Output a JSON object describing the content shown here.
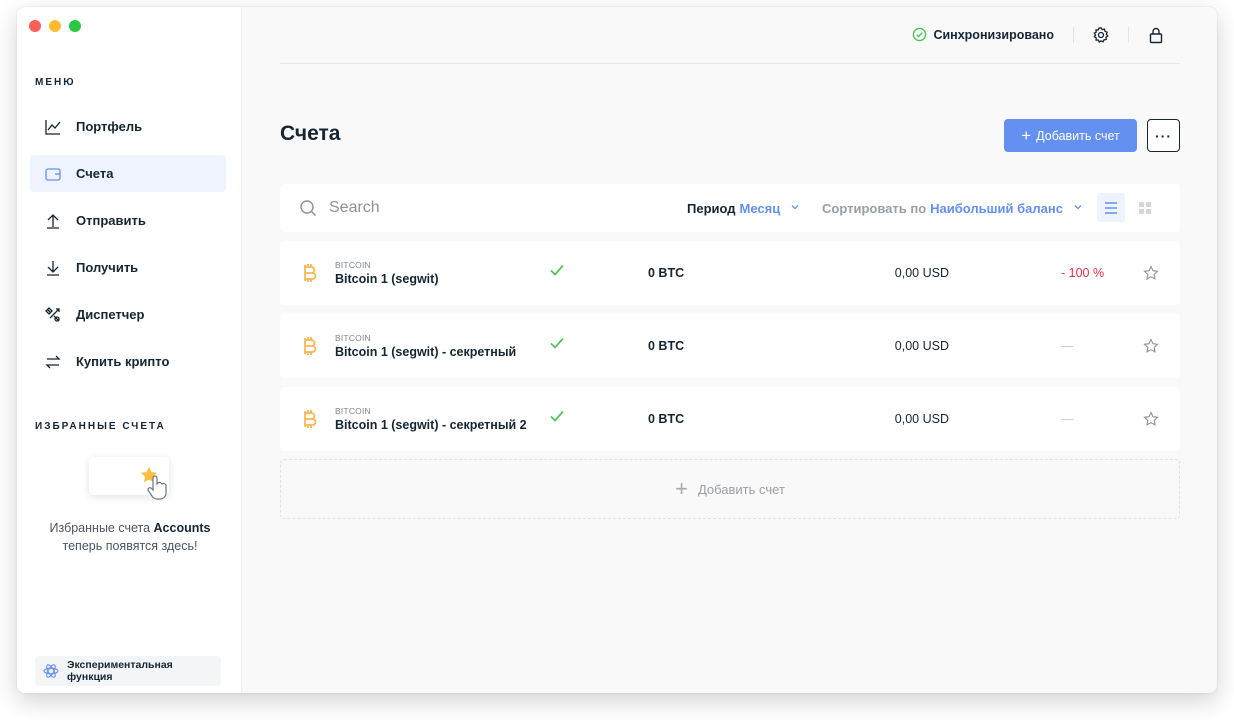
{
  "window": {
    "controls": [
      "close",
      "minimize",
      "maximize"
    ]
  },
  "sidebar": {
    "menu_title": "МЕНЮ",
    "items": [
      {
        "label": "Портфель",
        "icon": "chart-line-icon",
        "active": false
      },
      {
        "label": "Счета",
        "icon": "wallet-icon",
        "active": true
      },
      {
        "label": "Отправить",
        "icon": "arrow-up-icon",
        "active": false
      },
      {
        "label": "Получить",
        "icon": "arrow-down-icon",
        "active": false
      },
      {
        "label": "Диспетчер",
        "icon": "tools-icon",
        "active": false
      },
      {
        "label": "Купить крипто",
        "icon": "exchange-icon",
        "active": false
      }
    ],
    "favorites_title": "ИЗБРАННЫЕ СЧЕТА",
    "favorites_text_1": "Избранные счета ",
    "favorites_text_bold": "Accounts",
    "favorites_text_2": "теперь появятся здесь!",
    "experimental_label": "Экспериментальная функция"
  },
  "topbar": {
    "sync_status": "Синхронизировано",
    "sync_color": "#4fc15a",
    "icons": [
      "settings-icon",
      "lock-icon"
    ]
  },
  "main": {
    "title": "Счета",
    "add_button": "Добавить счет",
    "more_button": "···",
    "accent_color": "#6490f1",
    "search_placeholder": "Search",
    "period_label": "Период",
    "period_value": "Месяц",
    "sort_label": "Сортировать по",
    "sort_value": "Наибольший баланс",
    "view_modes": [
      "list",
      "grid"
    ],
    "accounts": [
      {
        "currency": "BITCOIN",
        "name": "Bitcoin 1 (segwit)",
        "synced": true,
        "balance": "0 BTC",
        "fiat": "0,00 USD",
        "change": "- 100 %",
        "starred": false
      },
      {
        "currency": "BITCOIN",
        "name": "Bitcoin 1 (segwit) - секретный",
        "synced": true,
        "balance": "0 BTC",
        "fiat": "0,00 USD",
        "change": "—",
        "starred": false
      },
      {
        "currency": "BITCOIN",
        "name": "Bitcoin 1 (segwit) - секретный 2",
        "synced": true,
        "balance": "0 BTC",
        "fiat": "0,00 USD",
        "change": "—",
        "starred": false
      }
    ],
    "add_row_label": "Добавить счет"
  }
}
